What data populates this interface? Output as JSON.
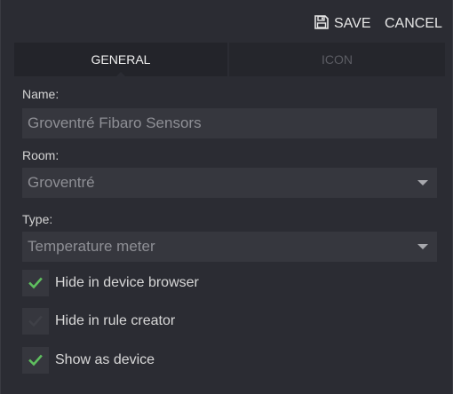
{
  "toolbar": {
    "save_label": "SAVE",
    "cancel_label": "CANCEL"
  },
  "tabs": [
    {
      "label": "GENERAL",
      "active": true
    },
    {
      "label": "ICON",
      "active": false
    }
  ],
  "form": {
    "name": {
      "label": "Name:",
      "value": "Groventré Fibaro Sensors"
    },
    "room": {
      "label": "Room:",
      "value": "Groventré"
    },
    "type": {
      "label": "Type:",
      "value": "Temperature meter"
    }
  },
  "checkboxes": [
    {
      "label": "Hide in device browser",
      "checked": true
    },
    {
      "label": "Hide in rule creator",
      "checked": false
    },
    {
      "label": "Show as device",
      "checked": true
    }
  ],
  "colors": {
    "background": "#2b2c33",
    "field": "#36373e",
    "check_on": "#5fbf5f",
    "check_off": "#3f4047"
  }
}
